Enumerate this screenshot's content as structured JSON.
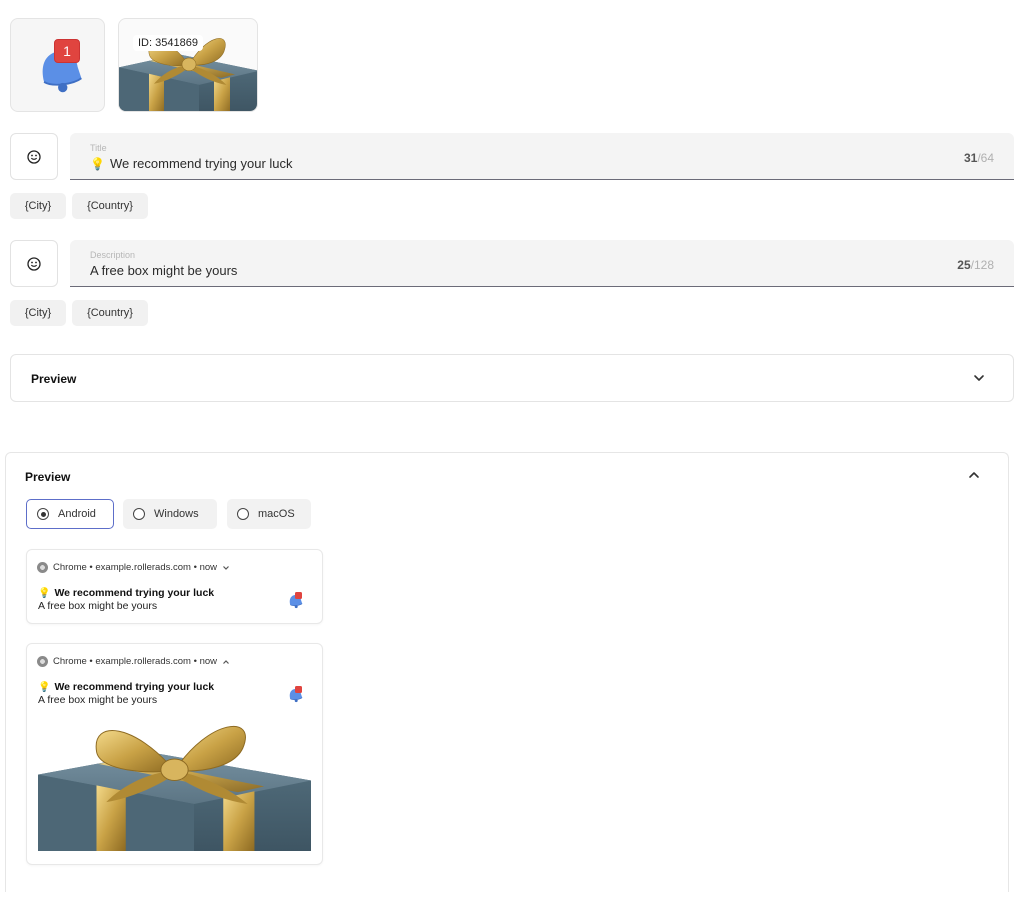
{
  "image_tile": {
    "id_label": "ID: 3541869"
  },
  "notification_badge": "1",
  "title_field": {
    "label": "Title",
    "emoji": "💡",
    "value": "We recommend trying your luck",
    "count": "31",
    "max": "/64"
  },
  "title_chips": [
    "{City}",
    "{Country}"
  ],
  "description_field": {
    "label": "Description",
    "value": "A free box might be yours",
    "count": "25",
    "max": "/128"
  },
  "description_chips": [
    "{City}",
    "{Country}"
  ],
  "preview_collapsed": {
    "title": "Preview"
  },
  "preview_expanded": {
    "title": "Preview",
    "platforms": [
      "Android",
      "Windows",
      "macOS"
    ],
    "selected_platform": "Android"
  },
  "notifications": [
    {
      "source": "Chrome • example.rollerads.com • now",
      "emoji": "💡",
      "title": "We recommend trying your luck",
      "description": "A free box might be yours",
      "state": "collapsed"
    },
    {
      "source": "Chrome • example.rollerads.com • now",
      "emoji": "💡",
      "title": "We recommend trying your luck",
      "description": "A free box might be yours",
      "state": "expanded"
    }
  ],
  "icons": [
    "bell-icon",
    "gift-box-icon",
    "smiley-icon",
    "chevron-down-icon",
    "chevron-up-icon",
    "chrome-icon"
  ],
  "colors": {
    "badge": "#e0443f",
    "bell": "#5b8fe6",
    "radio_active_border": "#5d6ec9",
    "gift_box": "#5c7584",
    "ribbon": "#c9a246"
  }
}
